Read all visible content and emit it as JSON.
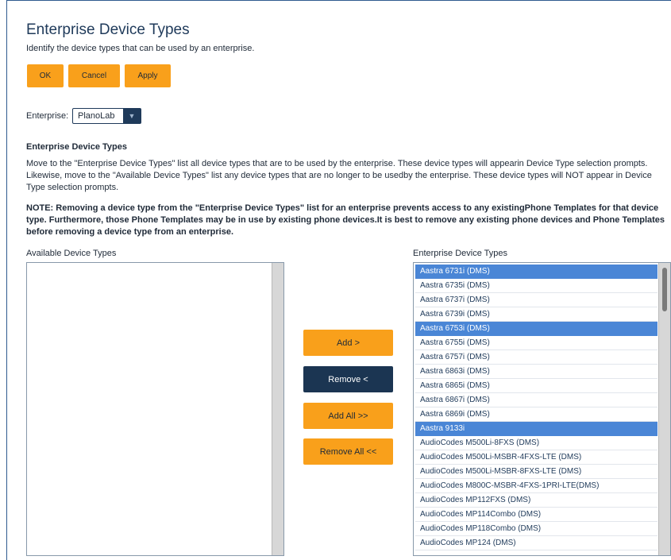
{
  "page": {
    "title": "Enterprise Device Types",
    "subtitle": "Identify the device types that can be used by an enterprise."
  },
  "actions": {
    "ok": "OK",
    "cancel": "Cancel",
    "apply": "Apply"
  },
  "enterprise": {
    "label": "Enterprise:",
    "selected": "PlanoLab"
  },
  "section": {
    "heading": "Enterprise Device Types",
    "description": "Move to the \"Enterprise Device Types\" list all device types that are to be used by the enterprise. These device types will appearin Device Type selection prompts. Likewise, move to the \"Available Device Types\" list any device types that are no longer to be usedby the enterprise. These device types will NOT appear in Device Type selection prompts.",
    "note": "NOTE: Removing a device type from the \"Enterprise Device Types\" list for an enterprise prevents access to any existingPhone Templates for that device type. Furthermore, those Phone Templates may be in use by existing phone devices.It is best to remove any existing phone devices and Phone Templates before removing a device type from an enterprise."
  },
  "available": {
    "label": "Available Device Types",
    "items": []
  },
  "transfer": {
    "add": "Add >",
    "remove": "Remove <",
    "add_all": "Add All >>",
    "remove_all": "Remove All <<"
  },
  "enterprise_types": {
    "label": "Enterprise Device Types",
    "items": [
      {
        "name": "Aastra 6731i (DMS)",
        "selected": true
      },
      {
        "name": "Aastra 6735i (DMS)",
        "selected": false
      },
      {
        "name": "Aastra 6737i (DMS)",
        "selected": false
      },
      {
        "name": "Aastra 6739i (DMS)",
        "selected": false
      },
      {
        "name": "Aastra 6753i (DMS)",
        "selected": true
      },
      {
        "name": "Aastra 6755i (DMS)",
        "selected": false
      },
      {
        "name": "Aastra 6757i (DMS)",
        "selected": false
      },
      {
        "name": "Aastra 6863i (DMS)",
        "selected": false
      },
      {
        "name": "Aastra 6865i (DMS)",
        "selected": false
      },
      {
        "name": "Aastra 6867i (DMS)",
        "selected": false
      },
      {
        "name": "Aastra 6869i (DMS)",
        "selected": false
      },
      {
        "name": "Aastra 9133i",
        "selected": true
      },
      {
        "name": "AudioCodes M500Li-8FXS (DMS)",
        "selected": false
      },
      {
        "name": "AudioCodes M500Li-MSBR-4FXS-LTE (DMS)",
        "selected": false
      },
      {
        "name": "AudioCodes M500Li-MSBR-8FXS-LTE (DMS)",
        "selected": false
      },
      {
        "name": "AudioCodes M800C-MSBR-4FXS-1PRI-LTE(DMS)",
        "selected": false
      },
      {
        "name": "AudioCodes MP112FXS (DMS)",
        "selected": false
      },
      {
        "name": "AudioCodes MP114Combo (DMS)",
        "selected": false
      },
      {
        "name": "AudioCodes MP118Combo (DMS)",
        "selected": false
      },
      {
        "name": "AudioCodes MP124 (DMS)",
        "selected": false
      }
    ]
  }
}
